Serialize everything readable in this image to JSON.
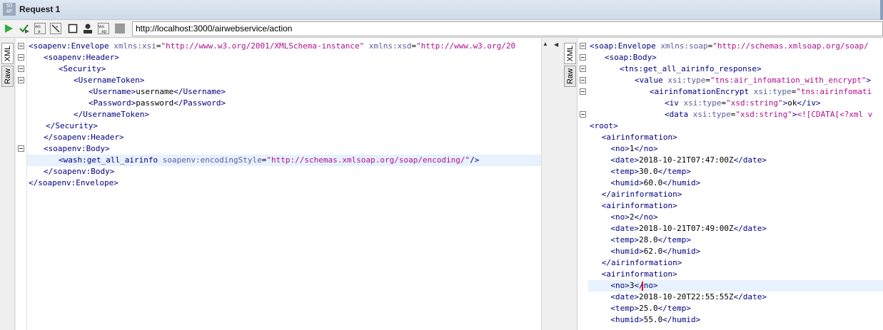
{
  "window": {
    "title": "Request 1",
    "logo": "SO AP"
  },
  "toolbar": {
    "icons": [
      "play-icon",
      "check-play-icon",
      "ws-a-icon",
      "ws-b-icon",
      "stop-icon",
      "user-icon",
      "ws-c-icon",
      "square-icon"
    ],
    "url": "http://localhost:3000/airwebservice/action"
  },
  "left_tabs": [
    {
      "label": "XML"
    },
    {
      "label": "Raw"
    }
  ],
  "right_tabs": [
    {
      "label": "XML"
    },
    {
      "label": "Raw"
    }
  ],
  "request_lines": [
    {
      "indent": 0,
      "fold": true,
      "parts": [
        [
          "tag",
          "<soapenv:Envelope "
        ],
        [
          "attr",
          "xmlns:xsi"
        ],
        [
          "txt",
          "="
        ],
        [
          "val",
          "\"http://www.w3.org/2001/XMLSchema-instance\""
        ],
        [
          "txt",
          " "
        ],
        [
          "attr",
          "xmlns:xsd"
        ],
        [
          "txt",
          "="
        ],
        [
          "val",
          "\"http://www.w3.org/20"
        ]
      ]
    },
    {
      "indent": 1,
      "fold": true,
      "parts": [
        [
          "tag",
          "<soapenv:Header>"
        ]
      ]
    },
    {
      "indent": 2,
      "fold": true,
      "parts": [
        [
          "tag",
          "<Security>"
        ]
      ]
    },
    {
      "indent": 3,
      "fold": true,
      "parts": [
        [
          "tag",
          "<UsernameToken>"
        ]
      ]
    },
    {
      "indent": 4,
      "fold": false,
      "parts": [
        [
          "tag",
          "<Username>"
        ],
        [
          "txt",
          "username"
        ],
        [
          "tag",
          "</Username>"
        ]
      ]
    },
    {
      "indent": 4,
      "fold": false,
      "parts": [
        [
          "tag",
          "<Password>"
        ],
        [
          "txt",
          "password"
        ],
        [
          "tag",
          "</Password>"
        ]
      ]
    },
    {
      "indent": 3,
      "fold": false,
      "parts": [
        [
          "tag",
          "</UsernameToken>"
        ]
      ]
    },
    {
      "indent": 1.15,
      "fold": false,
      "parts": [
        [
          "tag",
          "</Security>"
        ]
      ]
    },
    {
      "indent": 1,
      "fold": false,
      "parts": [
        [
          "tag",
          "</soapenv:Header>"
        ]
      ]
    },
    {
      "indent": 1,
      "fold": true,
      "parts": [
        [
          "tag",
          "<soapenv:Body>"
        ]
      ]
    },
    {
      "indent": 2,
      "fold": false,
      "hl": true,
      "parts": [
        [
          "tag",
          "<wash:get_all_airinfo "
        ],
        [
          "attr",
          "soapenv:encodingStyle"
        ],
        [
          "txt",
          "="
        ],
        [
          "val",
          "\"http://schemas.xmlsoap.org/soap/encoding/\""
        ],
        [
          "tag",
          "/>"
        ]
      ]
    },
    {
      "indent": 1,
      "fold": false,
      "parts": [
        [
          "tag",
          "</soapenv:Body>"
        ]
      ]
    },
    {
      "indent": 0,
      "fold": false,
      "parts": [
        [
          "tag",
          "</soapenv:Envelope>"
        ]
      ]
    }
  ],
  "response_lines": [
    {
      "indent": 0,
      "fold": true,
      "parts": [
        [
          "tag",
          "<soap:Envelope "
        ],
        [
          "attr",
          "xmlns:soap"
        ],
        [
          "txt",
          "="
        ],
        [
          "val",
          "\"http://schemas.xmlsoap.org/soap/"
        ]
      ]
    },
    {
      "indent": 1,
      "fold": true,
      "parts": [
        [
          "tag",
          "<soap:Body>"
        ]
      ]
    },
    {
      "indent": 2,
      "fold": true,
      "parts": [
        [
          "tag",
          "<tns:get_all_airinfo_response>"
        ]
      ]
    },
    {
      "indent": 3,
      "fold": true,
      "parts": [
        [
          "tag",
          "<value "
        ],
        [
          "attr",
          "xsi:type"
        ],
        [
          "txt",
          "="
        ],
        [
          "val",
          "\"tns:air_infomation_with_encrypt\""
        ],
        [
          "tag",
          ">"
        ]
      ]
    },
    {
      "indent": 4,
      "fold": true,
      "parts": [
        [
          "tag",
          "<airinfomationEncrypt "
        ],
        [
          "attr",
          "xsi:type"
        ],
        [
          "txt",
          "="
        ],
        [
          "val",
          "\"tns:airinfomati"
        ]
      ]
    },
    {
      "indent": 5,
      "fold": false,
      "parts": [
        [
          "tag",
          "<iv "
        ],
        [
          "attr",
          "xsi:type"
        ],
        [
          "txt",
          "="
        ],
        [
          "val",
          "\"xsd:string\""
        ],
        [
          "tag",
          ">"
        ],
        [
          "txt",
          "ok"
        ],
        [
          "tag",
          "</iv>"
        ]
      ]
    },
    {
      "indent": 5,
      "fold": true,
      "parts": [
        [
          "tag",
          "<data "
        ],
        [
          "attr",
          "xsi:type"
        ],
        [
          "txt",
          "="
        ],
        [
          "val",
          "\"xsd:string\""
        ],
        [
          "tag",
          ">"
        ],
        [
          "val",
          "<![CDATA[<?xml v"
        ]
      ]
    },
    {
      "indent": 0,
      "fold": false,
      "parts": [
        [
          "tag",
          "<root>"
        ]
      ]
    },
    {
      "indent": 0.8,
      "fold": false,
      "parts": [
        [
          "tag",
          "<airinformation>"
        ]
      ]
    },
    {
      "indent": 1.4,
      "fold": false,
      "parts": [
        [
          "tag",
          "<no>"
        ],
        [
          "txt",
          "1"
        ],
        [
          "tag",
          "</no>"
        ]
      ]
    },
    {
      "indent": 1.4,
      "fold": false,
      "parts": [
        [
          "tag",
          "<date>"
        ],
        [
          "txt",
          "2018-10-21T07:47:00Z"
        ],
        [
          "tag",
          "</date>"
        ]
      ]
    },
    {
      "indent": 1.4,
      "fold": false,
      "parts": [
        [
          "tag",
          "<temp>"
        ],
        [
          "txt",
          "30.0"
        ],
        [
          "tag",
          "</temp>"
        ]
      ]
    },
    {
      "indent": 1.4,
      "fold": false,
      "parts": [
        [
          "tag",
          "<humid>"
        ],
        [
          "txt",
          "60.0"
        ],
        [
          "tag",
          "</humid>"
        ]
      ]
    },
    {
      "indent": 0.8,
      "fold": false,
      "parts": [
        [
          "tag",
          "</airinformation>"
        ]
      ]
    },
    {
      "indent": 0.8,
      "fold": false,
      "parts": [
        [
          "tag",
          "<airinformation>"
        ]
      ]
    },
    {
      "indent": 1.4,
      "fold": false,
      "parts": [
        [
          "tag",
          "<no>"
        ],
        [
          "txt",
          "2"
        ],
        [
          "tag",
          "</no>"
        ]
      ]
    },
    {
      "indent": 1.4,
      "fold": false,
      "parts": [
        [
          "tag",
          "<date>"
        ],
        [
          "txt",
          "2018-10-21T07:49:00Z"
        ],
        [
          "tag",
          "</date>"
        ]
      ]
    },
    {
      "indent": 1.4,
      "fold": false,
      "parts": [
        [
          "tag",
          "<temp>"
        ],
        [
          "txt",
          "28.0"
        ],
        [
          "tag",
          "</temp>"
        ]
      ]
    },
    {
      "indent": 1.4,
      "fold": false,
      "parts": [
        [
          "tag",
          "<humid>"
        ],
        [
          "txt",
          "62.0"
        ],
        [
          "tag",
          "</humid>"
        ]
      ]
    },
    {
      "indent": 0.8,
      "fold": false,
      "parts": [
        [
          "tag",
          "</airinformation>"
        ]
      ]
    },
    {
      "indent": 0.8,
      "fold": false,
      "parts": [
        [
          "tag",
          "<airinformation>"
        ]
      ]
    },
    {
      "indent": 1.4,
      "fold": false,
      "hl": true,
      "cursor": true,
      "parts": [
        [
          "tag",
          "<no>"
        ],
        [
          "txt",
          "3"
        ],
        [
          "tag",
          "</no>"
        ]
      ]
    },
    {
      "indent": 1.4,
      "fold": false,
      "parts": [
        [
          "tag",
          "<date>"
        ],
        [
          "txt",
          "2018-10-20T22:55:55Z"
        ],
        [
          "tag",
          "</date>"
        ]
      ]
    },
    {
      "indent": 1.4,
      "fold": false,
      "parts": [
        [
          "tag",
          "<temp>"
        ],
        [
          "txt",
          "25.0"
        ],
        [
          "tag",
          "</temp>"
        ]
      ]
    },
    {
      "indent": 1.4,
      "fold": false,
      "parts": [
        [
          "tag",
          "<humid>"
        ],
        [
          "txt",
          "55.0"
        ],
        [
          "tag",
          "</humid>"
        ]
      ]
    }
  ],
  "colors": {
    "tag": "#000080",
    "attr": "#5b5b9e",
    "value": "#b0108f",
    "highlight": "#e8f2fe"
  }
}
